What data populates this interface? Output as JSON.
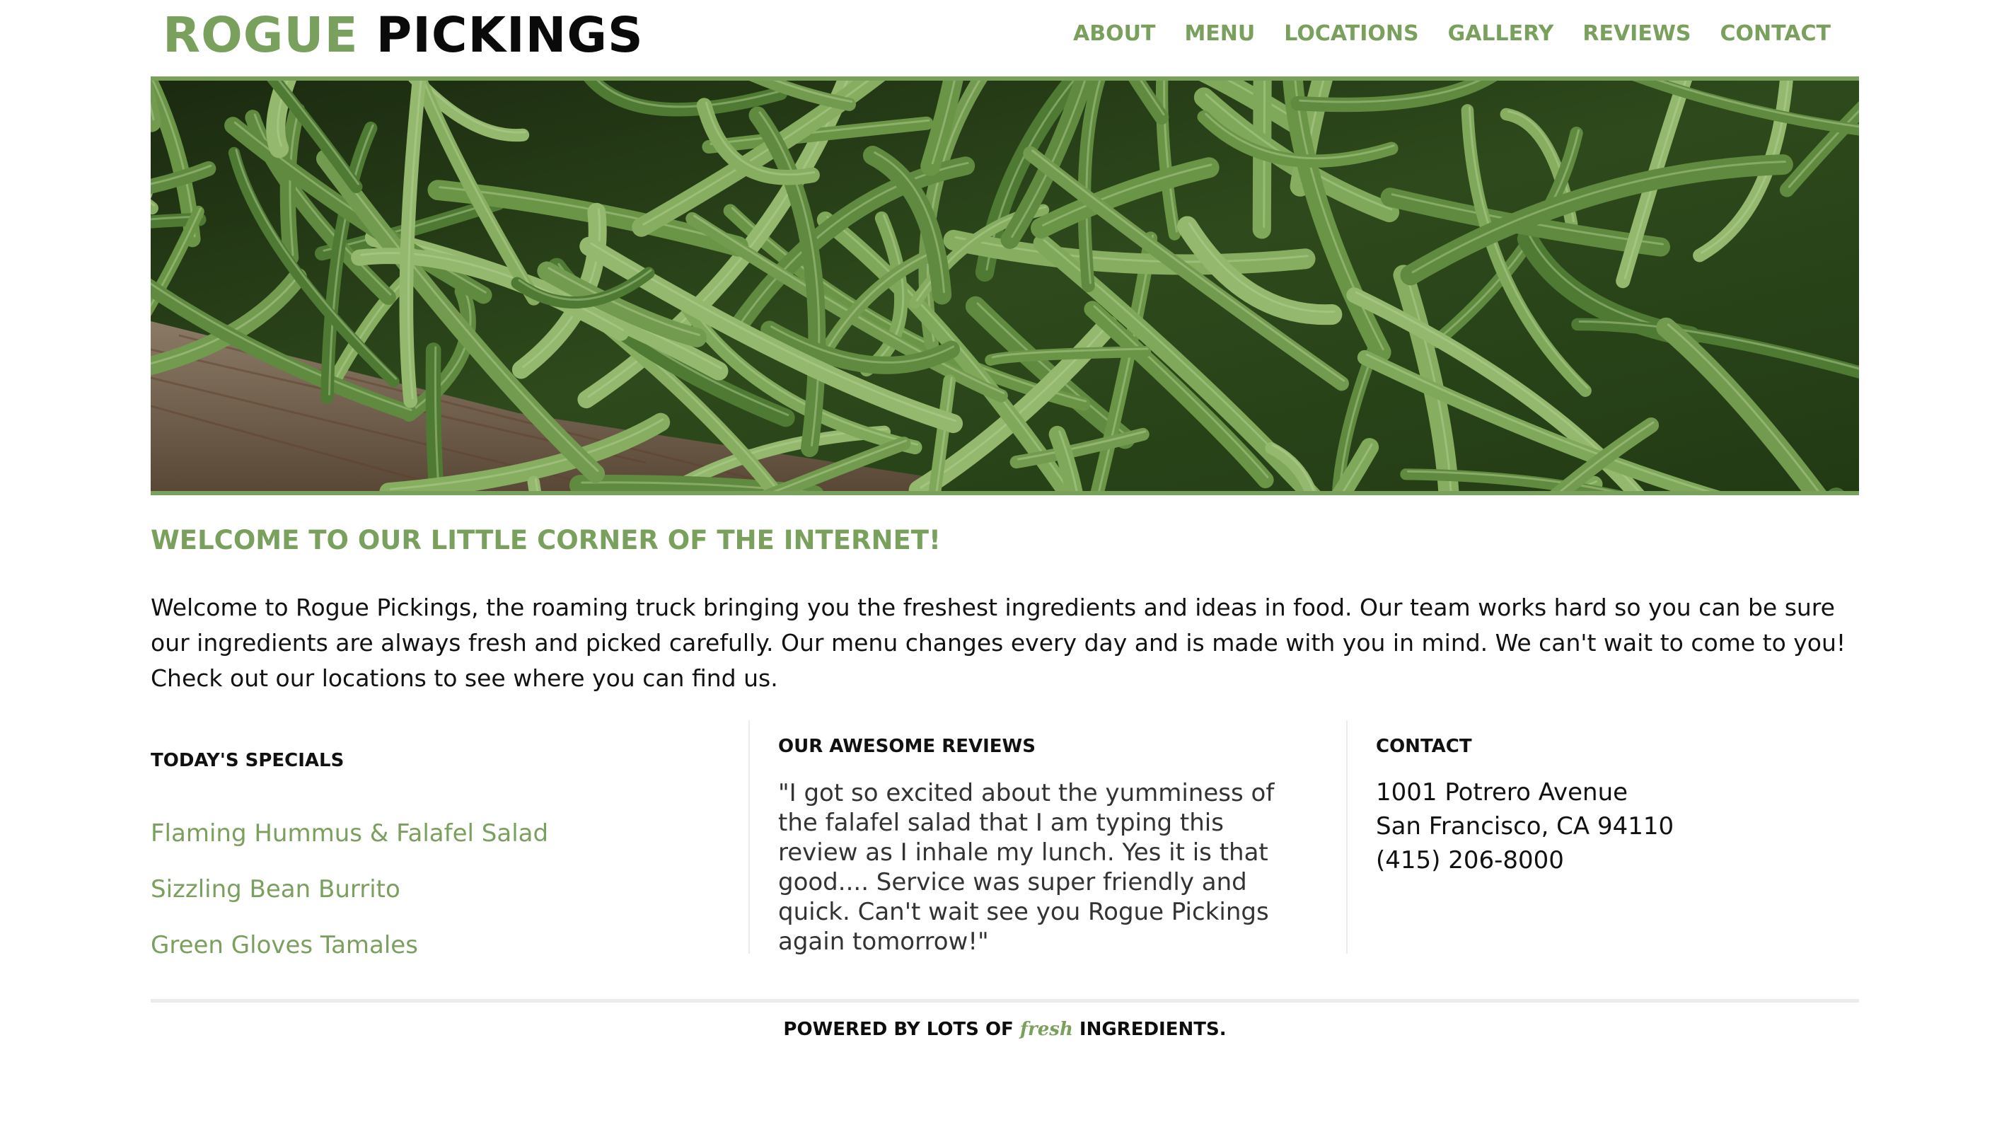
{
  "brand": {
    "part1": "ROGUE",
    "part2": "PICKINGS"
  },
  "nav": [
    "ABOUT",
    "MENU",
    "LOCATIONS",
    "GALLERY",
    "REVIEWS",
    "CONTACT"
  ],
  "welcome": {
    "title": "WELCOME TO OUR LITTLE CORNER OF THE INTERNET!",
    "text": "Welcome to Rogue Pickings, the roaming truck bringing you the freshest ingredients and ideas in food. Our team works hard so you can be sure our ingredients are always fresh and picked carefully. Our menu changes every day and is made with you in mind. We can't wait to come to you! Check out our locations to see where you can find us."
  },
  "specials": {
    "title": "TODAY'S SPECIALS",
    "items": [
      "Flaming Hummus & Falafel Salad",
      "Sizzling Bean Burrito",
      "Green Gloves Tamales"
    ]
  },
  "reviews": {
    "title": "OUR AWESOME REVIEWS",
    "text": "\"I got so excited about the yumminess of the falafel salad that I am typing this review as I inhale my lunch. Yes it is that good.... Service was super friendly and quick. Can't wait see you Rogue Pickings again tomorrow!\""
  },
  "contact": {
    "title": "CONTACT",
    "address1": "1001 Potrero Avenue",
    "address2": "San Francisco, CA 94110",
    "phone": "(415) 206-8000"
  },
  "footer": {
    "before": "POWERED BY LOTS OF",
    "fresh": "fresh",
    "after": "INGREDIENTS."
  },
  "colors": {
    "accent": "#7aa05d",
    "text": "#111111"
  }
}
